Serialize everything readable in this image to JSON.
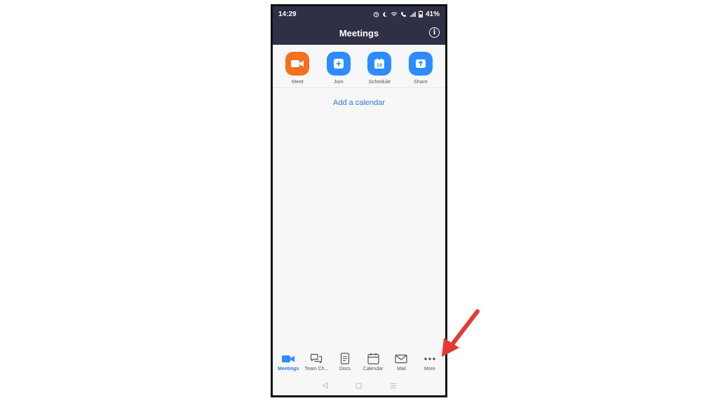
{
  "status_bar": {
    "time": "14:29",
    "battery": "41%"
  },
  "header": {
    "title": "Meetings"
  },
  "actions": [
    {
      "label": "Meet",
      "icon": "video-camera-icon",
      "color": "#f5701f"
    },
    {
      "label": "Join",
      "icon": "plus-icon",
      "color": "#2d8cff"
    },
    {
      "label": "Schedule",
      "icon": "calendar-icon",
      "color": "#2d8cff",
      "badge": "19"
    },
    {
      "label": "Share",
      "icon": "share-upload-icon",
      "color": "#2d8cff"
    }
  ],
  "add_calendar": "Add a calendar",
  "tabs": [
    {
      "label": "Meetings",
      "icon": "video-camera-icon",
      "active": true
    },
    {
      "label": "Team Ch...",
      "icon": "chat-bubbles-icon"
    },
    {
      "label": "Docs",
      "icon": "document-icon"
    },
    {
      "label": "Calendar",
      "icon": "calendar-icon"
    },
    {
      "label": "Mail",
      "icon": "mail-icon"
    },
    {
      "label": "More",
      "icon": "more-dots-icon"
    }
  ],
  "colors": {
    "header_bg": "#2f2f45",
    "accent": "#2d8cff",
    "meet": "#f5701f",
    "arrow": "#e53935"
  }
}
